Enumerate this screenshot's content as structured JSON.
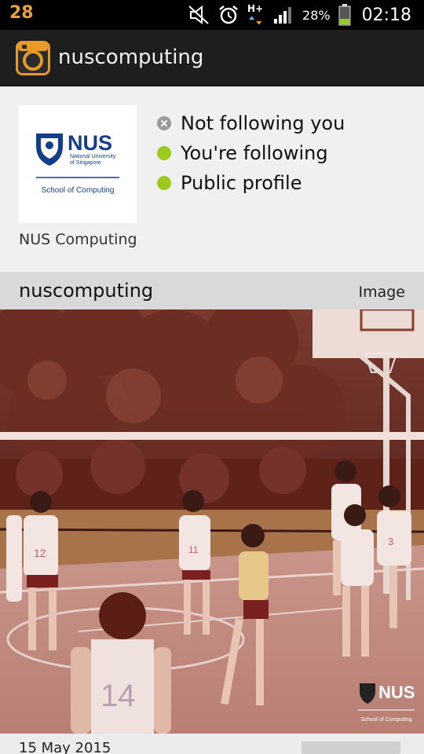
{
  "status_bar": {
    "notification_count": "28",
    "battery_percent": "28%",
    "network": "H+",
    "time": "02:18",
    "icons": [
      "mute-icon",
      "alarm-icon",
      "network-hplus-icon",
      "signal-icon",
      "battery-icon"
    ]
  },
  "app_bar": {
    "icon": "instagram-camera-icon",
    "title": "nuscomputing"
  },
  "profile": {
    "avatar_logo": {
      "wordmark": "NUS",
      "subtitle_lines": [
        "National University",
        "of Singapore"
      ],
      "school": "School of Computing"
    },
    "display_name": "NUS Computing",
    "statuses": [
      {
        "label": "Not following you",
        "state": "inactive"
      },
      {
        "label": "You're following",
        "state": "active"
      },
      {
        "label": "Public profile",
        "state": "active"
      }
    ],
    "colors": {
      "active": "#9ccb1e",
      "inactive": "#9a9a9a"
    }
  },
  "post": {
    "username": "nuscomputing",
    "type": "Image",
    "watermark": {
      "wordmark": "NUS",
      "school": "School of Computing"
    },
    "jersey_numbers": [
      "12",
      "11",
      "3",
      "14"
    ],
    "date": "15 May 2015"
  }
}
